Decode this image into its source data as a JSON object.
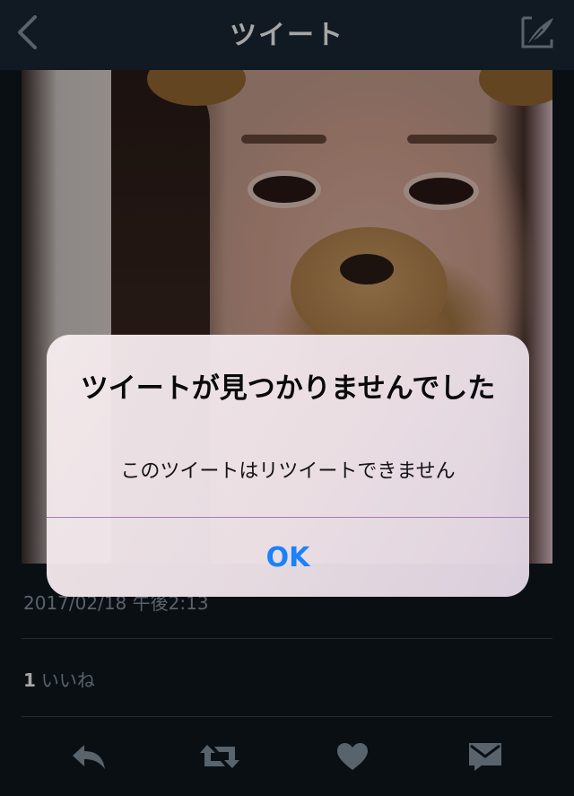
{
  "navbar": {
    "title": "ツイート",
    "back_icon": "chevron-left-icon",
    "compose_icon": "compose-quill-icon"
  },
  "tweet": {
    "photo_description_icon": "tweet-photo",
    "timestamp": "2017/02/18 午後2:13",
    "likes_count": "1",
    "likes_label": "いいね"
  },
  "actions": [
    {
      "name": "reply-icon"
    },
    {
      "name": "retweet-icon"
    },
    {
      "name": "like-heart-icon"
    },
    {
      "name": "direct-message-icon"
    }
  ],
  "alert": {
    "title": "ツイートが見つかりませんでした",
    "message": "このツイートはリツイートできません",
    "ok_label": "OK"
  },
  "colors": {
    "background": "#10171e",
    "navbar": "#1b2836",
    "secondary_text": "#8899a6",
    "alert_button": "#1a82fb"
  }
}
